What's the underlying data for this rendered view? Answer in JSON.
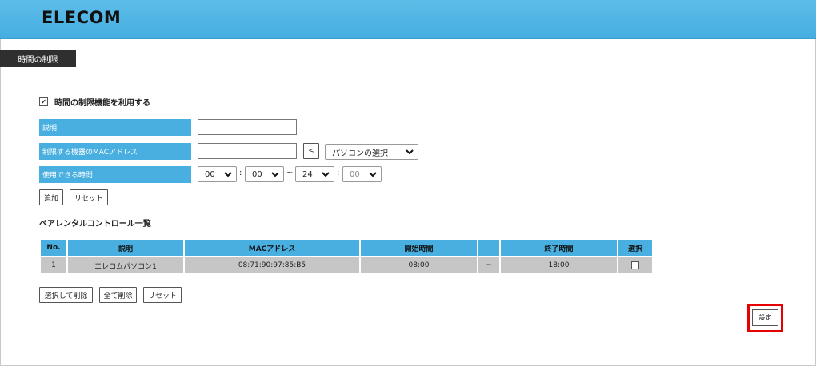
{
  "header": {
    "logo": "ELECOM"
  },
  "tabs": [
    {
      "label": "時間の制限",
      "active": true
    }
  ],
  "form": {
    "enable_label": "時間の制限機能を利用する",
    "enable_checked": true,
    "rows": {
      "description_label": "説明",
      "description_value": "",
      "mac_label": "制限する機器のMACアドレス",
      "mac_value": "",
      "mac_arrow": "<",
      "pc_select": "パソコンの選択",
      "time_label": "使用できる時間",
      "start_hour": "00",
      "start_min": "00",
      "end_hour": "24",
      "end_min": "00",
      "colon": ":",
      "tilde": "~"
    },
    "add_button": "追加",
    "reset_button": "リセット"
  },
  "list": {
    "title": "ペアレンタルコントロール一覧",
    "headers": {
      "no": "No.",
      "desc": "説明",
      "mac": "MACアドレス",
      "start": "開始時間",
      "sep": "",
      "end": "終了時間",
      "select": "選択"
    },
    "rows": [
      {
        "no": "1",
        "desc": "エレコムパソコン1",
        "mac": "08:71:90:97:85:B5",
        "start": "08:00",
        "sep": "~",
        "end": "18:00",
        "selected": false
      }
    ],
    "delete_selected_button": "選択して削除",
    "delete_all_button": "全て削除",
    "reset_button": "リセット"
  },
  "save_button": "設定",
  "colors": {
    "header": "#48afe0",
    "label_bg": "#48afe0",
    "row_bg": "#c6c6c6",
    "tab_bg": "#2f2f2f",
    "highlight": "#e60000"
  }
}
